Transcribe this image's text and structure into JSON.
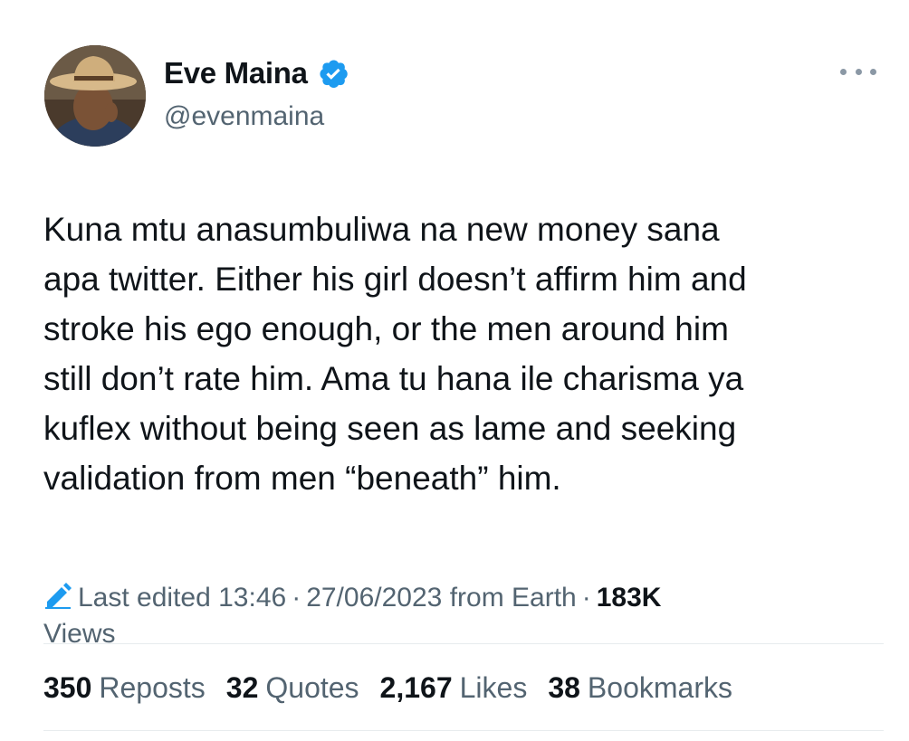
{
  "author": {
    "display_name": "Eve Maina",
    "handle": "@evenmaina",
    "verified": true,
    "verified_color": "#1d9bf0"
  },
  "more_menu": {
    "icon": "more-horizontal-icon"
  },
  "tweet": {
    "text": "Kuna mtu anasumbuliwa na new money sana\napa twitter. Either his girl doesn’t affirm him and\nstroke his ego enough, or the men around him\nstill don’t rate him. Ama tu hana ile charisma ya\nkuflex without being seen as lame and seeking\nvalidation from men “beneath” him."
  },
  "meta": {
    "edit_icon": "pencil-icon",
    "edited_label": "Last edited 13:46",
    "date": "27/06/2023",
    "source": "from Earth",
    "views_count": "183K",
    "views_label": "Views"
  },
  "stats": {
    "reposts_count": "350",
    "reposts_label": "Reposts",
    "quotes_count": "32",
    "quotes_label": "Quotes",
    "likes_count": "2,167",
    "likes_label": "Likes",
    "bookmarks_count": "38",
    "bookmarks_label": "Bookmarks"
  },
  "colors": {
    "text_primary": "#0f1419",
    "text_secondary": "#536471",
    "accent": "#1d9bf0",
    "divider": "#e7ebee"
  }
}
